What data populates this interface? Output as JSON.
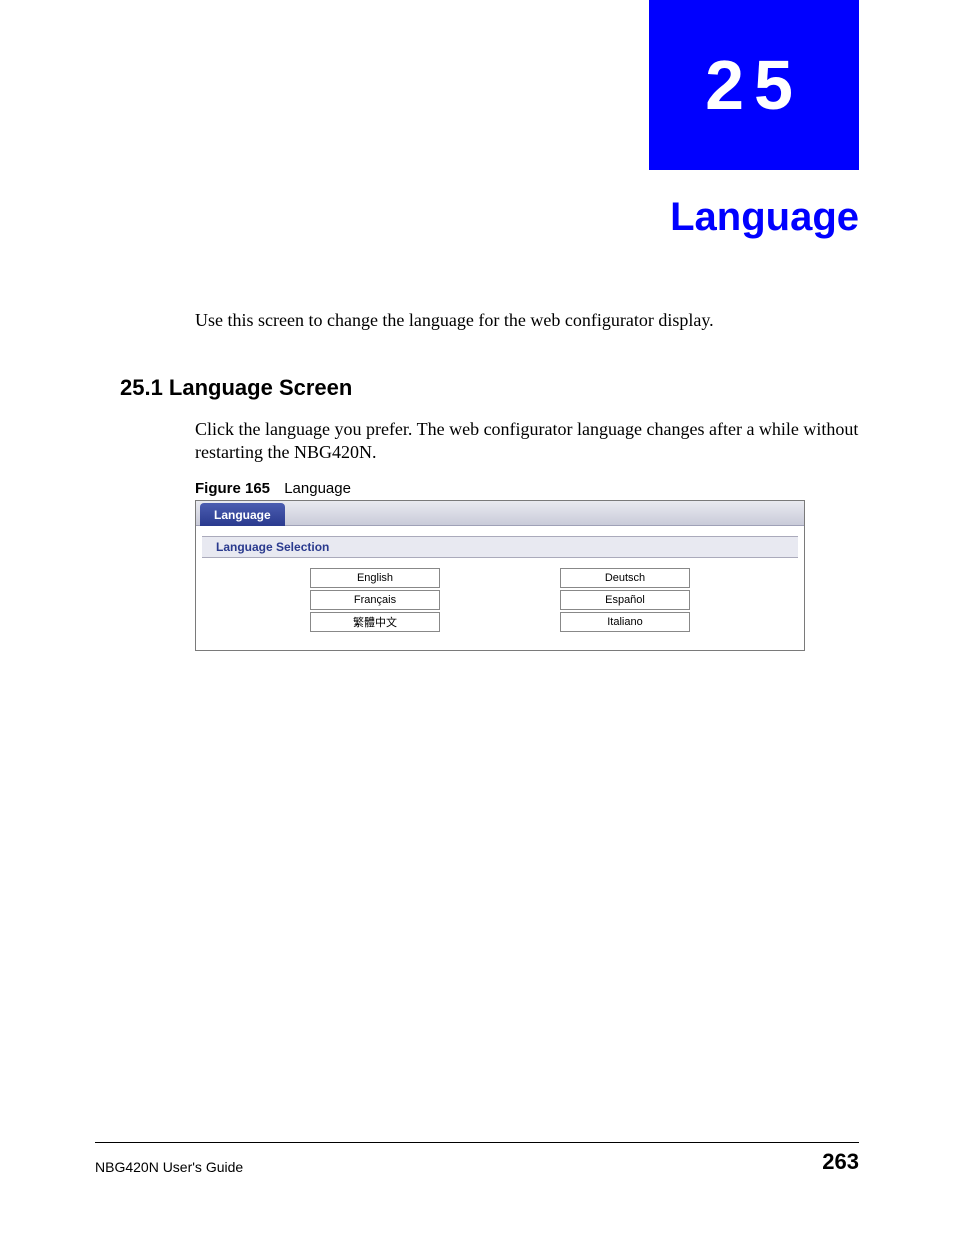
{
  "chapter": {
    "number": "25",
    "title": "Language"
  },
  "intro_text": "Use this screen to change the language for the web configurator display.",
  "section": {
    "heading": "25.1  Language Screen",
    "body": "Click the language you prefer. The web configurator language changes after a while without restarting the NBG420N."
  },
  "figure": {
    "label": "Figure 165",
    "title": "Language",
    "tab_label": "Language",
    "section_label": "Language Selection",
    "languages": {
      "col1": [
        "English",
        "Français",
        "繁體中文"
      ],
      "col2": [
        "Deutsch",
        "Español",
        "Italiano"
      ]
    }
  },
  "footer": {
    "guide": "NBG420N User's Guide",
    "page": "263"
  }
}
